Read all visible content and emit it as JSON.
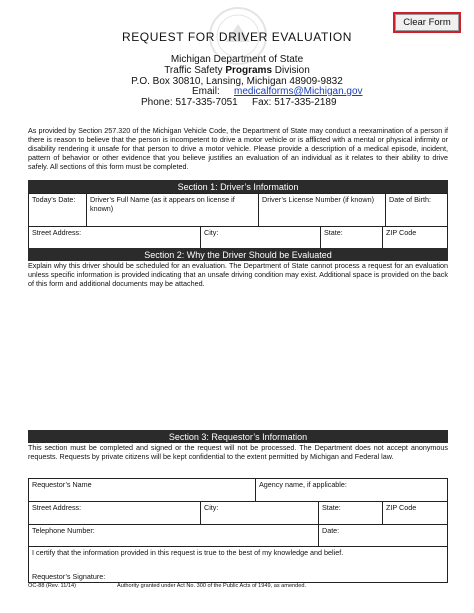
{
  "clear_button": "Clear Form",
  "title": "REQUEST FOR DRIVER EVALUATION",
  "agency": {
    "line1": "Michigan Department of State",
    "line2_pre": "Traffic Safety ",
    "line2_bold": "Programs",
    "line2_post": " Division",
    "line3": "P.O. Box 30810, Lansing, Michigan 48909-9832",
    "email_label": "Email:",
    "email": "medicalforms@Michigan.gov",
    "phone": "Phone:  517-335-7051",
    "fax": "Fax:  517-335-2189"
  },
  "intro": "As provided by Section 257.320 of the Michigan Vehicle Code, the Department of State may conduct a reexamination of a person if there is reason to believe that the person is incompetent to drive a motor vehicle or is afflicted with a mental or physical infirmity or disability rendering it unsafe for that person to drive a motor vehicle. Please provide a description of a medical episode, incident, pattern of behavior or other evidence that you believe justifies an evaluation of an individual as it relates to their ability to drive safely. All sections of this form must be completed.",
  "section1": {
    "title": "Section 1: Driver’s Information",
    "todays_date": "Today’s Date:",
    "full_name": "Driver’s Full Name (as it appears on license if known)",
    "license_number": "Driver’s License Number (if known)",
    "birth_date": "Date of Birth:",
    "street": "Street Address:",
    "city": "City:",
    "state": "State:",
    "zip": "ZIP Code"
  },
  "section2": {
    "title": "Section 2: Why the Driver Should be Evaluated",
    "text": "Explain why this driver should be scheduled for an evaluation. The Department of State cannot process a request for an evaluation unless specific information is provided indicating that an unsafe driving condition may exist. Additional space is provided on the back of this form and additional documents may be attached."
  },
  "section3": {
    "title": "Section 3: Requestor’s Information",
    "text": "This section must be completed and signed or the request will not be processed. The Department does not accept anonymous requests. Requests by private citizens will be kept confidential to the extent permitted by Michigan and Federal law.",
    "requestor_name": "Requestor’s Name",
    "agency_name": "Agency name, if applicable:",
    "street": "Street Address:",
    "city": "City:",
    "state": "State:",
    "zip": "ZIP Code",
    "telephone": "Telephone Number:",
    "date": "Date:",
    "certify": "I certify that the information provided in this request is true to the best of my knowledge and belief.",
    "signature": "Requestor’s Signature:"
  },
  "footer": {
    "form_id": "OC-88 (Rev. 11/14)",
    "authority": "Authority granted under Act No. 300 of the Public Acts of 1949, as amended."
  }
}
